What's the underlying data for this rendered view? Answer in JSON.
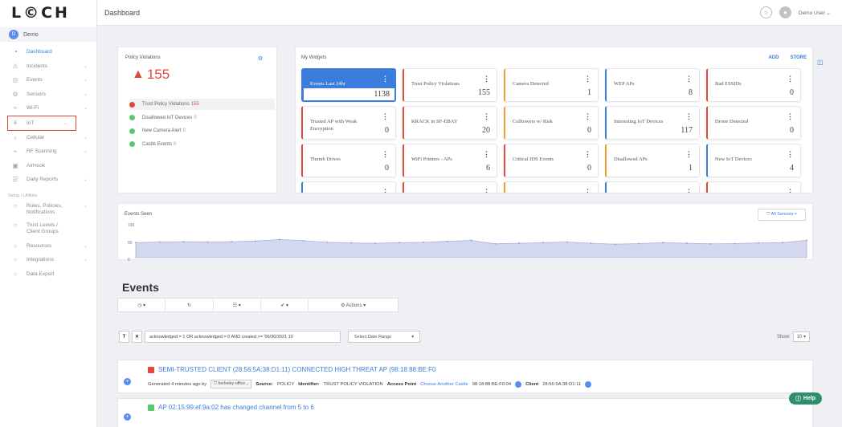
{
  "brand": "L©CH",
  "header": {
    "title": "Dashboard",
    "user": "Demo User ⌄"
  },
  "org": {
    "initial": "D",
    "name": "Demo"
  },
  "sidebar": {
    "items": [
      {
        "label": "Dashboard",
        "icon": "dashboard-icon",
        "glyph": "◔",
        "active": true
      },
      {
        "label": "Incidents",
        "icon": "alert-icon",
        "glyph": "⚠",
        "chev": true
      },
      {
        "label": "Events",
        "icon": "events-icon",
        "glyph": "◎",
        "chev": true
      },
      {
        "label": "Sensors",
        "icon": "sensor-icon",
        "glyph": "⚙",
        "chev": true
      },
      {
        "label": "Wi-Fi",
        "icon": "wifi-icon",
        "glyph": "≈",
        "chev": true
      },
      {
        "label": "IoT",
        "icon": "iot-icon",
        "glyph": "⚘",
        "chev": true,
        "highlight": true
      },
      {
        "label": "Cellular",
        "icon": "cellular-icon",
        "glyph": "♁",
        "chev": true
      },
      {
        "label": "RF Scanning",
        "icon": "rf-icon",
        "glyph": "⌁",
        "chev": true
      },
      {
        "label": "AirHook",
        "icon": "airhook-icon",
        "glyph": "▣"
      },
      {
        "label": "Daily Reports",
        "icon": "report-icon",
        "glyph": "☰",
        "chev": true
      }
    ],
    "section": "Setup / Utilities",
    "setup": [
      {
        "label": "Rules, Policies, Notifications",
        "chev": true
      },
      {
        "label": "Trust Levels / Client Groups"
      },
      {
        "label": "Resources",
        "chev": true
      },
      {
        "label": "Integrations",
        "chev": true
      },
      {
        "label": "Data Export"
      }
    ]
  },
  "policy": {
    "title": "Policy Violations",
    "total": "155",
    "rows": [
      {
        "label": "Trust Policy Violations",
        "count": "155",
        "color": "#e0483b",
        "selected": true
      },
      {
        "label": "Disallowed IoT Devices",
        "count": "0",
        "color": "#5cc76e"
      },
      {
        "label": "New Camera Alert",
        "count": "0",
        "color": "#5cc76e"
      },
      {
        "label": "Castle Events",
        "count": "0",
        "color": "#5cc76e"
      }
    ]
  },
  "widgets": {
    "title": "My Widgets",
    "add": "ADD",
    "store": "STORE",
    "tiles": [
      {
        "name": "Events Last 24hr",
        "value": "1138",
        "color": "#3b7ddd",
        "hi": true
      },
      {
        "name": "Trust Policy Violations",
        "value": "155",
        "color": "#e0483b"
      },
      {
        "name": "Camera Detected",
        "value": "1",
        "color": "#f0a030"
      },
      {
        "name": "WEP APs",
        "value": "8",
        "color": "#3b7ddd"
      },
      {
        "name": "Bad ESSIDs",
        "value": "0",
        "color": "#e0483b"
      },
      {
        "name": "Trusted AP with Weak Encryption",
        "value": "0",
        "color": "#e0483b"
      },
      {
        "name": "KRACK in SF-EBAY",
        "value": "20",
        "color": "#e0483b"
      },
      {
        "name": "Celltowers w/ Risk",
        "value": "0",
        "color": "#f0a030"
      },
      {
        "name": "Interesting IoT Devices",
        "value": "117",
        "color": "#3b7ddd"
      },
      {
        "name": "Drone Detected",
        "value": "0",
        "color": "#e0483b"
      },
      {
        "name": "Thumb Drives",
        "value": "0",
        "color": "#e0483b"
      },
      {
        "name": "WiFi Printers - APs",
        "value": "6",
        "color": "#e0483b"
      },
      {
        "name": "Critical IDS Events",
        "value": "0",
        "color": "#e0483b"
      },
      {
        "name": "Disallowed APs",
        "value": "1",
        "color": "#f0a030"
      },
      {
        "name": "New IoT Devices",
        "value": "4",
        "color": "#3b7ddd"
      },
      {
        "name": "",
        "value": "",
        "color": "#3b7ddd"
      },
      {
        "name": "",
        "value": "",
        "color": "#e0483b"
      },
      {
        "name": "",
        "value": "",
        "color": "#f0a030"
      },
      {
        "name": "",
        "value": "",
        "color": "#3b7ddd"
      },
      {
        "name": "",
        "value": "",
        "color": "#e0483b"
      }
    ]
  },
  "events_seen": {
    "title": "Events Seen",
    "y_labels": [
      "100",
      "50",
      "0"
    ],
    "sensors": "⛉ All Sensors ▾"
  },
  "chart_data": {
    "type": "area",
    "title": "Events Seen",
    "ylim": [
      0,
      100
    ],
    "yticks": [
      0,
      50,
      100
    ],
    "values": [
      48,
      50,
      51,
      50,
      51,
      53,
      58,
      54,
      49,
      47,
      46,
      48,
      49,
      52,
      55,
      44,
      46,
      48,
      50,
      46,
      43,
      45,
      48,
      46,
      44,
      45,
      47,
      48,
      55
    ]
  },
  "events": {
    "title": "Events",
    "toolbar": [
      "◷ ▾",
      "↻",
      "☷ ▾",
      "✔ ▾",
      "⚙ Actions ▾"
    ],
    "filter_query": "acknowledged = 1 OR acknowledged = 0 AND created >= '06/30/2021 10",
    "date_range": "Select Date Range",
    "show_label": "Show:",
    "show_value": "10 ▾",
    "rows": [
      {
        "title": "SEMI-TRUSTED CLIENT (28:56:5A:38:D1:11) CONNECTED HIGH THREAT AP (98:18:88:BE:F0",
        "generated": "Generated 4 minutes ago by",
        "sensor": "⛉ berkeley-office ⌄",
        "source_label": "Source:",
        "source": "POLICY",
        "identifier_label": "Identifier:",
        "identifier": "TRUST POLICY VIOLATION",
        "ap_label": "Access Point",
        "castle": "Choose Another Castle",
        "ap": "98:18:88:BE:F0:04",
        "client_label": "Client",
        "client": "28:56:5A:38:D1:11",
        "sq_color": "#e0483b"
      },
      {
        "title": "AP 02:15:99:ef:9a:02 has changed channel from 5 to 6",
        "sq_color": "#5cc76e"
      }
    ]
  },
  "help": {
    "label": "Help"
  }
}
